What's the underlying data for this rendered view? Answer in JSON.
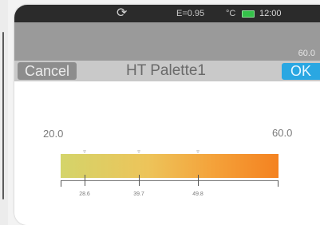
{
  "status_bar": {
    "rotate_icon": "rotate-icon",
    "emissivity": "E=0.95",
    "unit": "°C",
    "battery_icon": "battery-icon",
    "time": "12:00"
  },
  "preview": {
    "max_value": "60.0"
  },
  "header": {
    "cancel_label": "Cancel",
    "title": "HT Palette1",
    "ok_label": "OK"
  },
  "palette": {
    "min_value": "20.0",
    "max_value": "60.0",
    "marker_glyph": "▿",
    "ticks": [
      "28.6",
      "39.7",
      "49.8"
    ],
    "colors": {
      "start": "#d4d46a",
      "middle": "#edc45a",
      "end": "#f48220"
    }
  },
  "colors": {
    "ok_button": "#2aa7e2",
    "header_bg": "#c9c9c9",
    "cancel_button": "#8d8d8d"
  }
}
